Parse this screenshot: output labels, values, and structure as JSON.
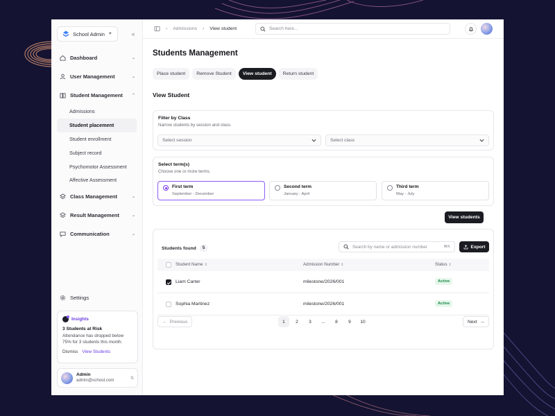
{
  "workspace": {
    "name": "School Admin"
  },
  "sidebar": {
    "groups": [
      {
        "label": "Dashboard",
        "icon": "home-icon"
      },
      {
        "label": "User Management",
        "icon": "user-icon"
      },
      {
        "label": "Student Management",
        "icon": "book-icon",
        "items": [
          "Admissions",
          "Student placement",
          "Student enrollment",
          "Subject record",
          "Psychomotor Assessment",
          "Affective Assessment"
        ],
        "active_item": "Student placement"
      },
      {
        "label": "Class Management",
        "icon": "layers-icon"
      },
      {
        "label": "Result Management",
        "icon": "layers-icon"
      },
      {
        "label": "Communication",
        "icon": "chat-icon"
      }
    ],
    "settings_label": "Settings",
    "insight": {
      "tag": "Insights",
      "title": "3 Students at Risk",
      "text": "Attendance has dropped below 75% for 3 students this month.",
      "dismiss": "Dismiss",
      "action": "View Students"
    },
    "user": {
      "name": "Admin",
      "email": "admin@school.com"
    }
  },
  "topbar": {
    "breadcrumb": [
      "Admissions",
      "View student"
    ],
    "search_placeholder": "Search here..."
  },
  "main": {
    "title": "Students Management",
    "tabs": [
      "Place student",
      "Remove Student",
      "View student",
      "Return student"
    ],
    "active_tab": "View student",
    "section_title": "View Student",
    "filter": {
      "title": "Filter by Class",
      "subtitle": "Narrow students by session and class.",
      "session_placeholder": "Select session",
      "class_placeholder": "Select class"
    },
    "terms": {
      "title": "Select term(s)",
      "subtitle": "Choose one or more terms.",
      "options": [
        {
          "name": "First term",
          "range": "September - December",
          "selected": true
        },
        {
          "name": "Second term",
          "range": "January - April",
          "selected": false
        },
        {
          "name": "Third term",
          "range": "May - July",
          "selected": false
        }
      ]
    },
    "view_button": "View students",
    "results": {
      "found_label": "Students found",
      "count": "5",
      "search_placeholder": "Search by name or admission number",
      "shortcut": "⌘K",
      "export_label": "Export",
      "columns": [
        "Student Name",
        "Admission Number",
        "Status"
      ],
      "rows": [
        {
          "name": "Liam Carter",
          "admission": "milestone/2026/001",
          "status": "Active",
          "checked": true
        },
        {
          "name": "Sophia Martinez",
          "admission": "milestone/2026/001",
          "status": "Active",
          "checked": false
        }
      ],
      "pagination": {
        "prev": "Previous",
        "next": "Next",
        "pages": [
          "1",
          "2",
          "3",
          "...",
          "8",
          "9",
          "10"
        ],
        "current": "1"
      }
    }
  },
  "colors": {
    "accent": "#7c3aed",
    "dark_button": "#1b1b22",
    "active_status": "#1a8a47"
  }
}
